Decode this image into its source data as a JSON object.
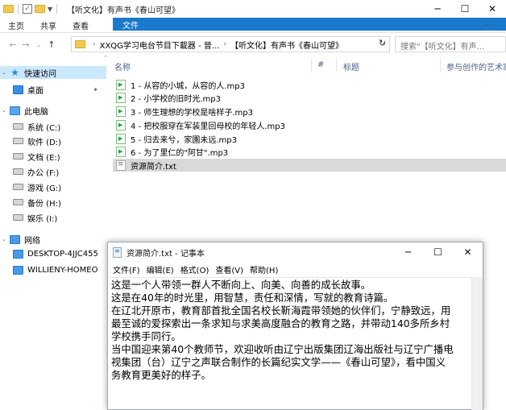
{
  "explorer": {
    "title": "【听文化】有声书《春山可望》",
    "ribbon_tabs": [
      "文件",
      "主页",
      "共享",
      "查看"
    ],
    "help_icon": "question-icon",
    "address": {
      "root": "XXQG学习电台节目下載器 - 晉...",
      "current": "【听文化】有声书《春山可望》"
    },
    "search_placeholder": "搜索\"【听文化】有声...",
    "columns": [
      "名称",
      "#",
      "标题",
      "参与创作的艺术家"
    ],
    "nav": {
      "quick_access": "快速访问",
      "desktop": "桌面",
      "this_pc": "此电脑",
      "drives": [
        "系统 (C:)",
        "软件 (D:)",
        "文档 (E:)",
        "办公 (F:)",
        "游戏 (G:)",
        "备份 (H:)",
        "娱乐 (I:)"
      ],
      "network": "网络",
      "computers": [
        "DESKTOP-4JJC455",
        "WILLIENY-HOMEO"
      ]
    },
    "files": [
      "1 - 从容的小城，从容的人.mp3",
      "2 - 小学校的旧时光.mp3",
      "3 - 师生理想的学校是啥样子.mp3",
      "4 - 把校服穿在军装里回母校的年轻人.mp3",
      "5 - 归去来兮，家園未远.mp3",
      "6 - 为了里仁的\"阿甘\".mp3",
      "资源简介.txt"
    ]
  },
  "notepad": {
    "title": "资源简介.txt - 记事本",
    "menu": [
      "文件(F)",
      "编辑(E)",
      "格式(O)",
      "查看(V)",
      "帮助(H)"
    ],
    "lines": [
      "这是一个人带领一群人不断向上、向美、向善的成长故事。",
      "这是在40年的时光里，用智慧，责任和深情，写就的教育诗篇。",
      "在辽北开原市，教育部首批全国名校长靳海霞带领她的伙伴们，宁静致远，用",
      "最至诚的爱探索出一条求知与求美高度融合的教育之路，并带动140多所乡村",
      "学校携手同行。",
      "当中国迎来第40个教师节，欢迎收听由辽宁出版集团辽海出版社与辽宁广播电",
      "视集团（台）辽宁之声联合制作的长篇纪实文学——《春山可望》，看中国义",
      "务教育更美好的样子。"
    ]
  }
}
